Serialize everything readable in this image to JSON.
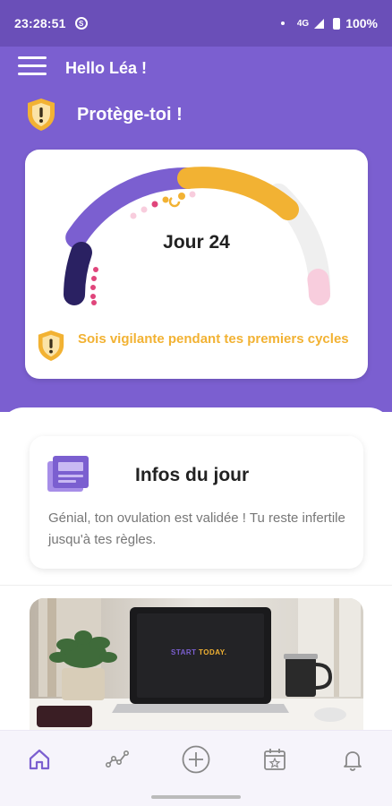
{
  "status_bar": {
    "time": "23:28:51",
    "sync_icon": "sync-icon",
    "network": "4G",
    "battery": "100%"
  },
  "header": {
    "menu_icon": "hamburger-menu-icon",
    "greeting": "Hello Léa !",
    "protection_title": "Protège-toi !",
    "background_color": "#7b5fd0"
  },
  "cycle": {
    "day_label": "Jour 24",
    "warning_text": "Sois vigilante pendant tes premiers cycles",
    "colors": {
      "period": "#2a2162",
      "follicular": "#7b5fd0",
      "ovulation": "#f2b233",
      "infertile": "#efefef",
      "upcoming_period": "#f8cddd",
      "warning": "#f2b233"
    }
  },
  "info": {
    "title": "Infos du jour",
    "body": "Génial, ton ovulation est validée ! Tu reste infertile jusqu'à tes règles."
  },
  "promo": {
    "screen_text_1": "START",
    "screen_text_2": "TODAY."
  },
  "bottom_nav": [
    {
      "icon": "home-icon",
      "active": true
    },
    {
      "icon": "chart-icon",
      "active": false
    },
    {
      "icon": "add-circle-icon",
      "active": false
    },
    {
      "icon": "calendar-icon",
      "active": false
    },
    {
      "icon": "bell-icon",
      "active": false
    }
  ]
}
